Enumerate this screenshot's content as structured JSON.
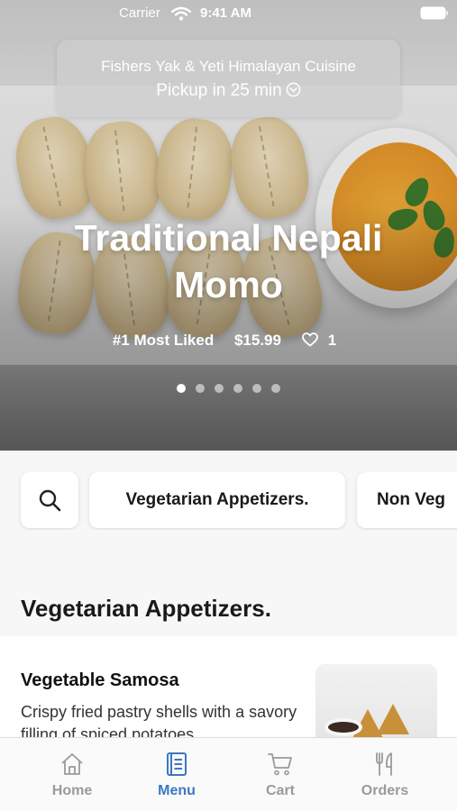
{
  "status_bar": {
    "carrier": "Carrier",
    "time": "9:41 AM"
  },
  "pickup": {
    "restaurant_name": "Fishers Yak & Yeti Himalayan Cuisine",
    "pickup_text": "Pickup in 25 min"
  },
  "hero": {
    "title_line1": "Traditional Nepali",
    "title_line2": "Momo",
    "rank": "#1 Most Liked",
    "price": "$15.99",
    "likes": "1",
    "carousel_total": 6,
    "carousel_active_index": 0
  },
  "categories": {
    "first": "Vegetarian Appetizers.",
    "second": "Non Veg"
  },
  "section": {
    "title": "Vegetarian Appetizers."
  },
  "item": {
    "name": "Vegetable Samosa",
    "description": "Crispy fried pastry shells with a savory filling of spiced potatoes..."
  },
  "tabs": {
    "home": "Home",
    "menu": "Menu",
    "cart": "Cart",
    "orders": "Orders",
    "active": "menu"
  },
  "colors": {
    "accent": "#3a78c2",
    "inactive_tab": "#9a9a9a"
  }
}
